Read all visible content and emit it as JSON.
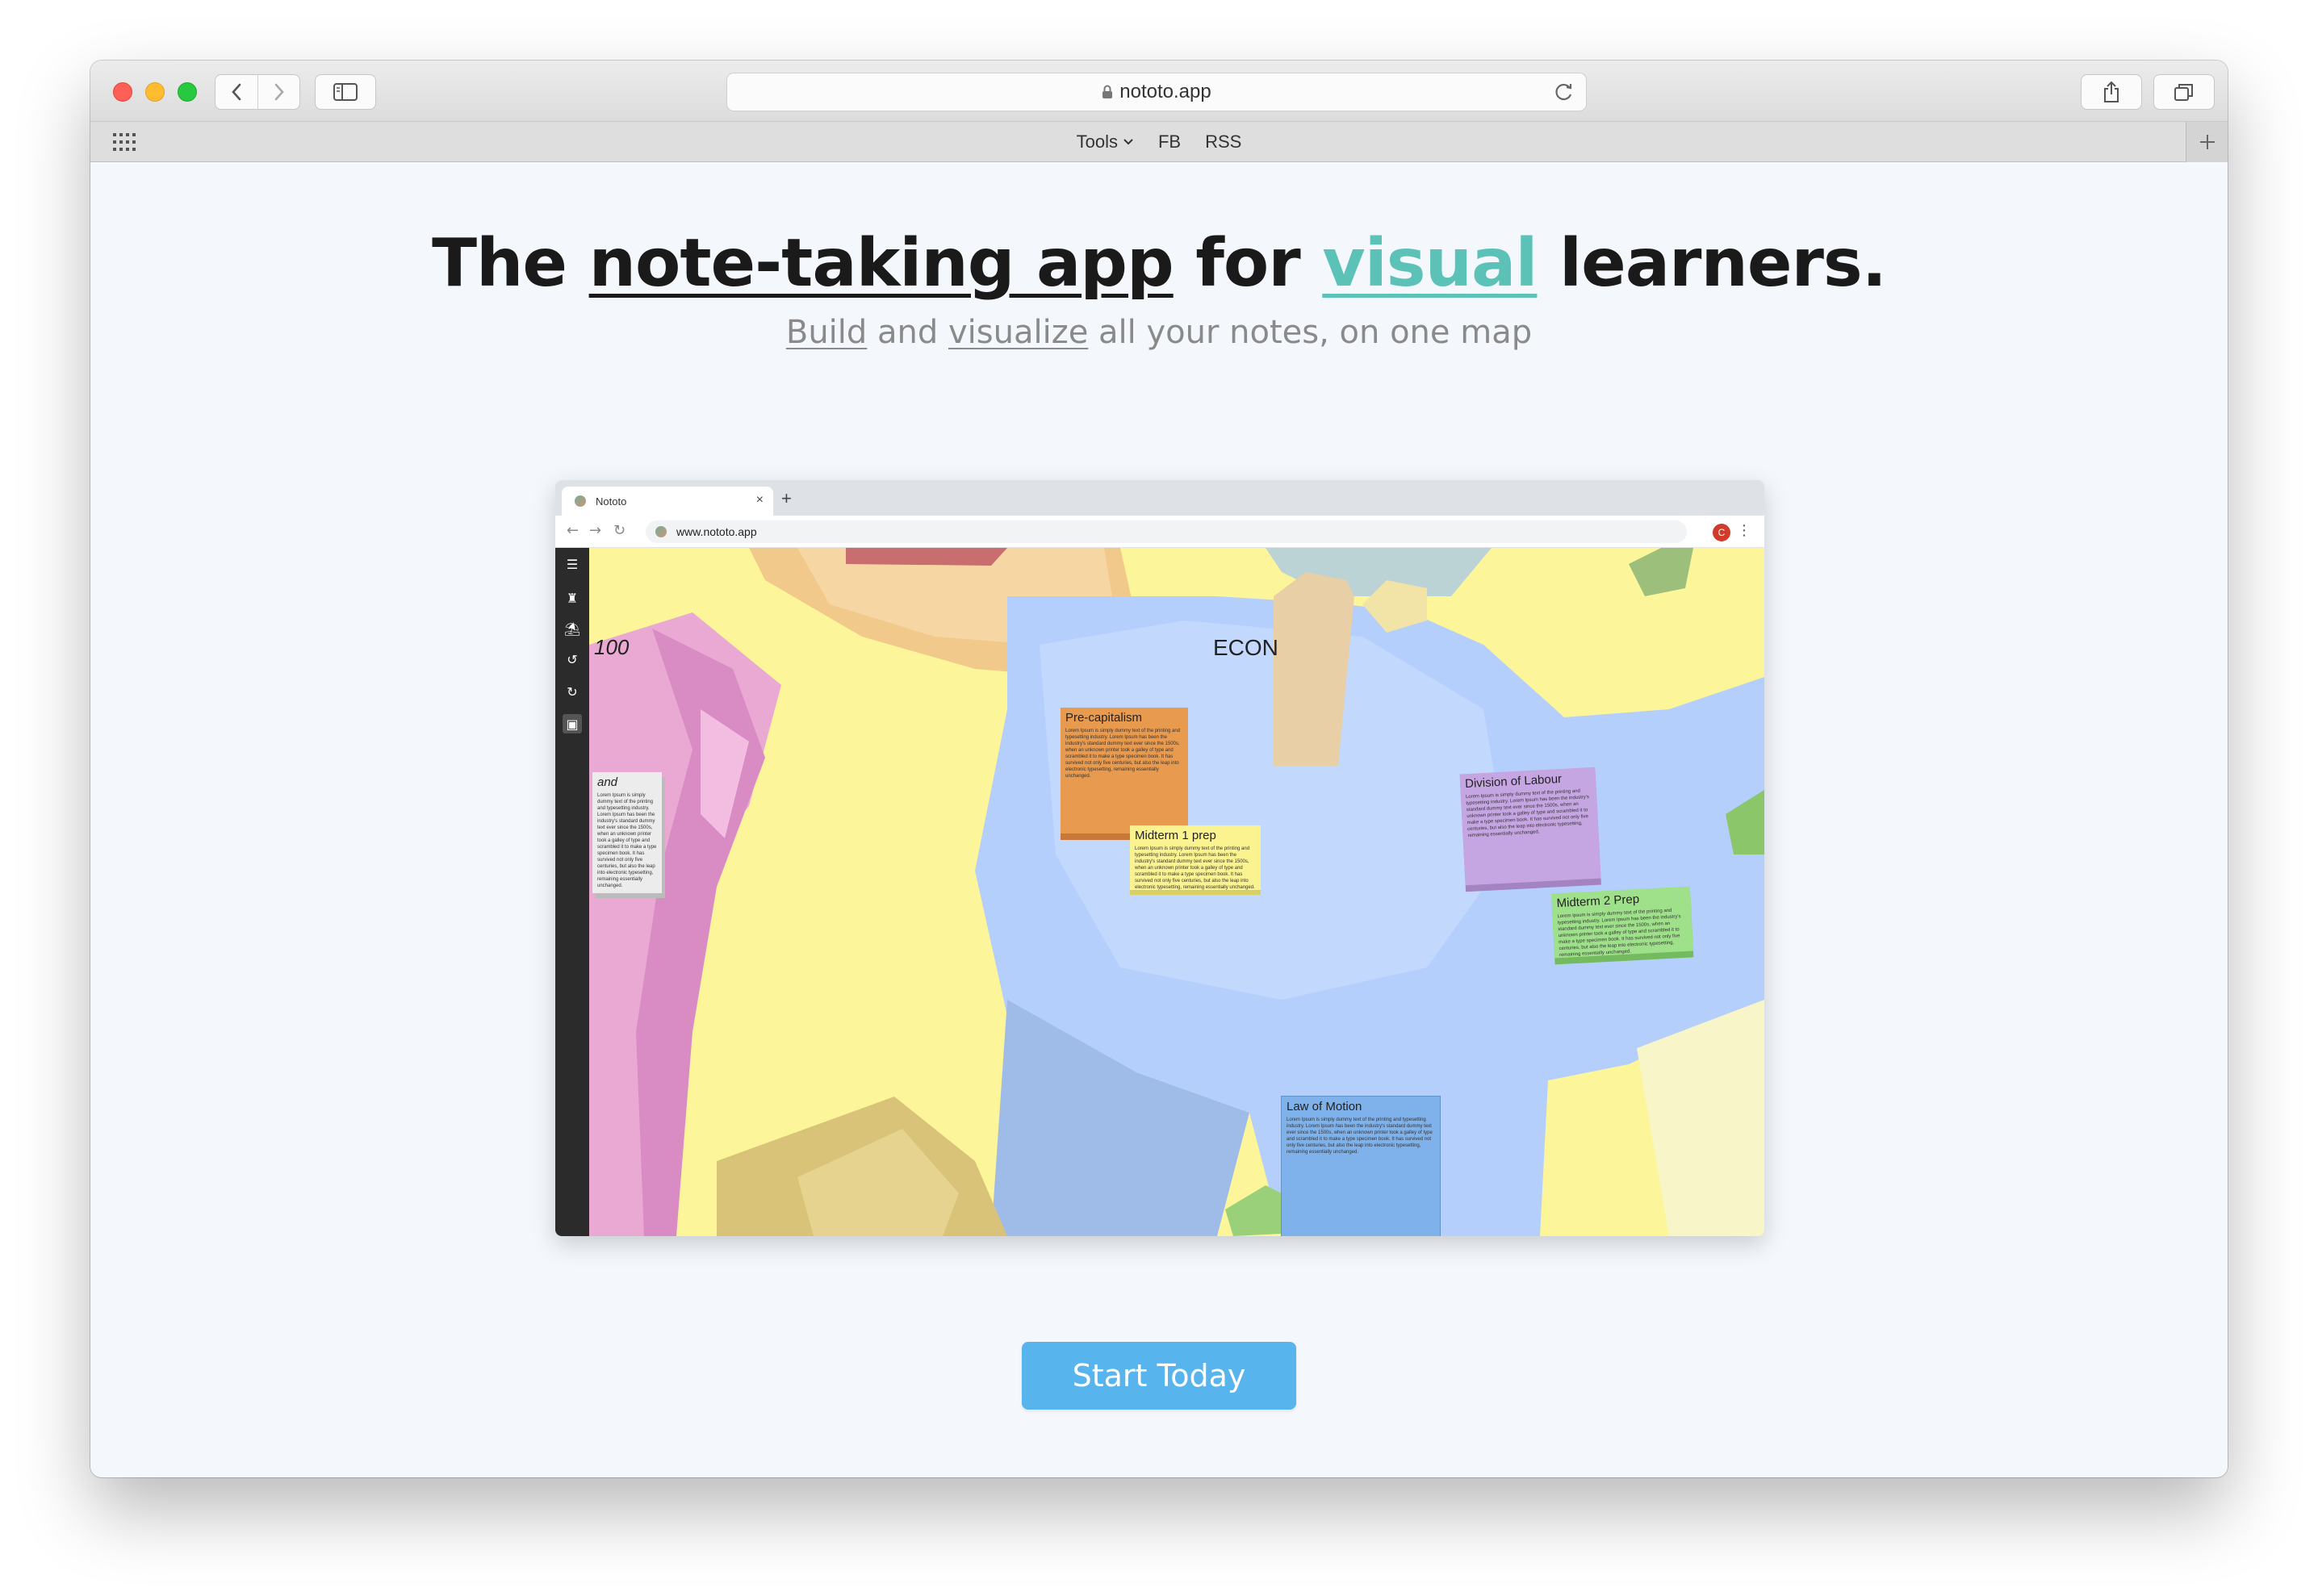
{
  "browser": {
    "url": "nototo.app",
    "bookmarks": [
      {
        "label": "Tools"
      },
      {
        "label": "FB"
      },
      {
        "label": "RSS"
      }
    ]
  },
  "hero": {
    "title_part1": "The ",
    "title_link1": "note-taking app",
    "title_part2": " for ",
    "title_accent": "visual",
    "title_part3": " learners.",
    "sub_link1": "Build",
    "sub_part1": " and ",
    "sub_link2": "visualize",
    "sub_part2": " all your notes, on one map"
  },
  "preview": {
    "tab_title": "Nototo",
    "url": "www.nototo.app",
    "profile_initial": "C",
    "counter": "100",
    "map_label": "ECON",
    "side_note_label": "and",
    "notes": [
      {
        "title": "Pre-capitalism",
        "color": "#e89a4e"
      },
      {
        "title": "Midterm 1 prep",
        "color": "#fbf38f"
      },
      {
        "title": "Division of Labour",
        "color": "#c6a6e2"
      },
      {
        "title": "Midterm 2 Prep",
        "color": "#9fe08a"
      },
      {
        "title": "Law of Motion",
        "color": "#7fb2ea"
      }
    ],
    "note_body": "Lorem Ipsum is simply dummy text of the printing and typesetting industry. Lorem Ipsum has been the industry's standard dummy text ever since the 1500s, when an unknown printer took a galley of type and scrambled it to make a type specimen book. It has survived not only five centuries, but also the leap into electronic typesetting, remaining essentially unchanged."
  },
  "cta": {
    "label": "Start Today"
  },
  "colors": {
    "accent": "#5cc1b6",
    "button": "#58b4ec"
  }
}
